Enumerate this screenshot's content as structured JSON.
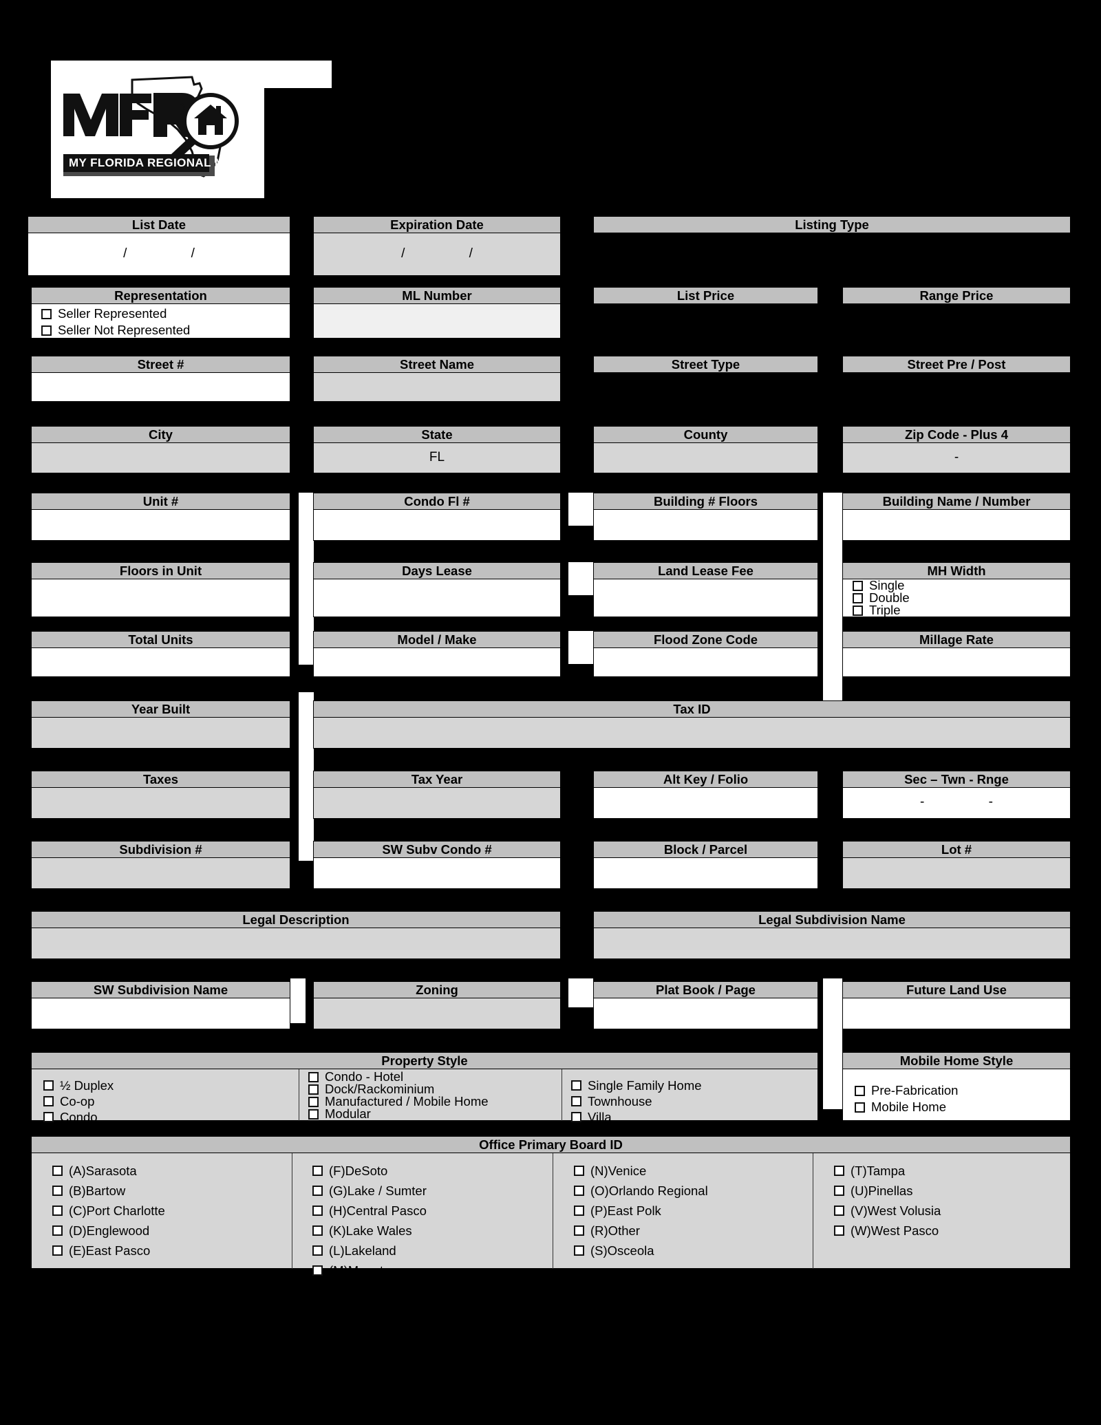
{
  "logo": {
    "brand": "MFR",
    "banner": "MY FLORIDA REGIONAL MLS",
    "alt": "My Florida Regional MLS logo with Florida outline, magnifying glass and house"
  },
  "colors": {
    "page_background": "#000000",
    "header_bar": "#c0c0c0",
    "field_gray": "#d6d6d6",
    "field_light_gray": "#f0f0f0",
    "field_white": "#ffffff"
  },
  "fields": {
    "list_date": {
      "label": "List Date",
      "value": "/     /"
    },
    "expiration_date": {
      "label": "Expiration Date",
      "value": "/     /"
    },
    "listing_type": {
      "label": "Listing Type",
      "value": ""
    },
    "representation": {
      "label": "Representation"
    },
    "ml_number": {
      "label": "ML Number",
      "value": ""
    },
    "list_price": {
      "label": "List Price",
      "value": ""
    },
    "range_price": {
      "label": "Range Price",
      "value": ""
    },
    "street_number": {
      "label": "Street #",
      "value": ""
    },
    "street_name": {
      "label": "Street Name",
      "value": ""
    },
    "street_type": {
      "label": "Street Type",
      "value": ""
    },
    "street_pre_post": {
      "label": "Street Pre / Post",
      "value": ""
    },
    "city": {
      "label": "City",
      "value": ""
    },
    "state": {
      "label": "State",
      "value": "FL"
    },
    "county": {
      "label": "County",
      "value": ""
    },
    "zip_code": {
      "label": "Zip Code - Plus 4",
      "value": "-"
    },
    "unit_number": {
      "label": "Unit #",
      "value": ""
    },
    "condo_fl_number": {
      "label": "Condo Fl #",
      "value": ""
    },
    "building_num_floors": {
      "label": "Building # Floors",
      "value": ""
    },
    "building_name_number": {
      "label": "Building Name / Number",
      "value": ""
    },
    "floors_in_unit": {
      "label": "Floors in Unit",
      "value": ""
    },
    "days_lease": {
      "label": "Days Lease",
      "value": ""
    },
    "land_lease_fee": {
      "label": "Land Lease Fee",
      "value": ""
    },
    "mh_width": {
      "label": "MH Width"
    },
    "total_units": {
      "label": "Total Units",
      "value": ""
    },
    "model_make": {
      "label": "Model / Make",
      "value": ""
    },
    "flood_zone_code": {
      "label": "Flood Zone Code",
      "value": ""
    },
    "millage_rate": {
      "label": "Millage Rate",
      "value": ""
    },
    "year_built": {
      "label": "Year Built",
      "value": ""
    },
    "tax_id": {
      "label": "Tax ID",
      "value": ""
    },
    "taxes": {
      "label": "Taxes",
      "value": ""
    },
    "tax_year": {
      "label": "Tax Year",
      "value": ""
    },
    "alt_key_folio": {
      "label": "Alt Key / Folio",
      "value": ""
    },
    "sec_twn_rnge": {
      "label": "Sec – Twn - Rnge",
      "value": "-     -"
    },
    "subdivision_number": {
      "label": "Subdivision #",
      "value": ""
    },
    "sw_subv_condo_number": {
      "label": "SW Subv Condo #",
      "value": ""
    },
    "block_parcel": {
      "label": "Block / Parcel",
      "value": ""
    },
    "lot_number": {
      "label": "Lot #",
      "value": ""
    },
    "legal_description": {
      "label": "Legal Description",
      "value": ""
    },
    "legal_subdivision_name": {
      "label": "Legal Subdivision Name",
      "value": ""
    },
    "sw_subdivision_name": {
      "label": "SW Subdivision Name",
      "value": ""
    },
    "zoning": {
      "label": "Zoning",
      "value": ""
    },
    "plat_book_page": {
      "label": "Plat Book / Page",
      "value": ""
    },
    "future_land_use": {
      "label": "Future Land Use",
      "value": ""
    },
    "property_style": {
      "label": "Property Style"
    },
    "mobile_home_style": {
      "label": "Mobile Home Style"
    },
    "office_primary_board_id": {
      "label": "Office Primary Board ID"
    }
  },
  "representation_options": [
    "Seller Represented",
    "Seller Not Represented"
  ],
  "mh_width_options": [
    "Single",
    "Double",
    "Triple"
  ],
  "property_style_columns": [
    [
      "½ Duplex",
      "Co-op",
      "Condo"
    ],
    [
      "Condo - Hotel",
      "Dock/Rackominium",
      "Manufactured / Mobile Home",
      "Modular"
    ],
    [
      "Single Family Home",
      "Townhouse",
      "Villa"
    ]
  ],
  "mobile_home_style_options": [
    "Pre-Fabrication",
    "Mobile Home"
  ],
  "office_board_columns": [
    [
      "(A)Sarasota",
      "(B)Bartow",
      "(C)Port Charlotte",
      "(D)Englewood",
      "(E)East Pasco"
    ],
    [
      "(F)DeSoto",
      "(G)Lake / Sumter",
      "(H)Central Pasco",
      "(K)Lake Wales",
      "(L)Lakeland",
      "(M)Manatee"
    ],
    [
      "(N)Venice",
      "(O)Orlando Regional",
      "(P)East Polk",
      "(R)Other",
      "(S)Osceola"
    ],
    [
      "(T)Tampa",
      "(U)Pinellas",
      "(V)West Volusia",
      "(W)West Pasco"
    ]
  ]
}
